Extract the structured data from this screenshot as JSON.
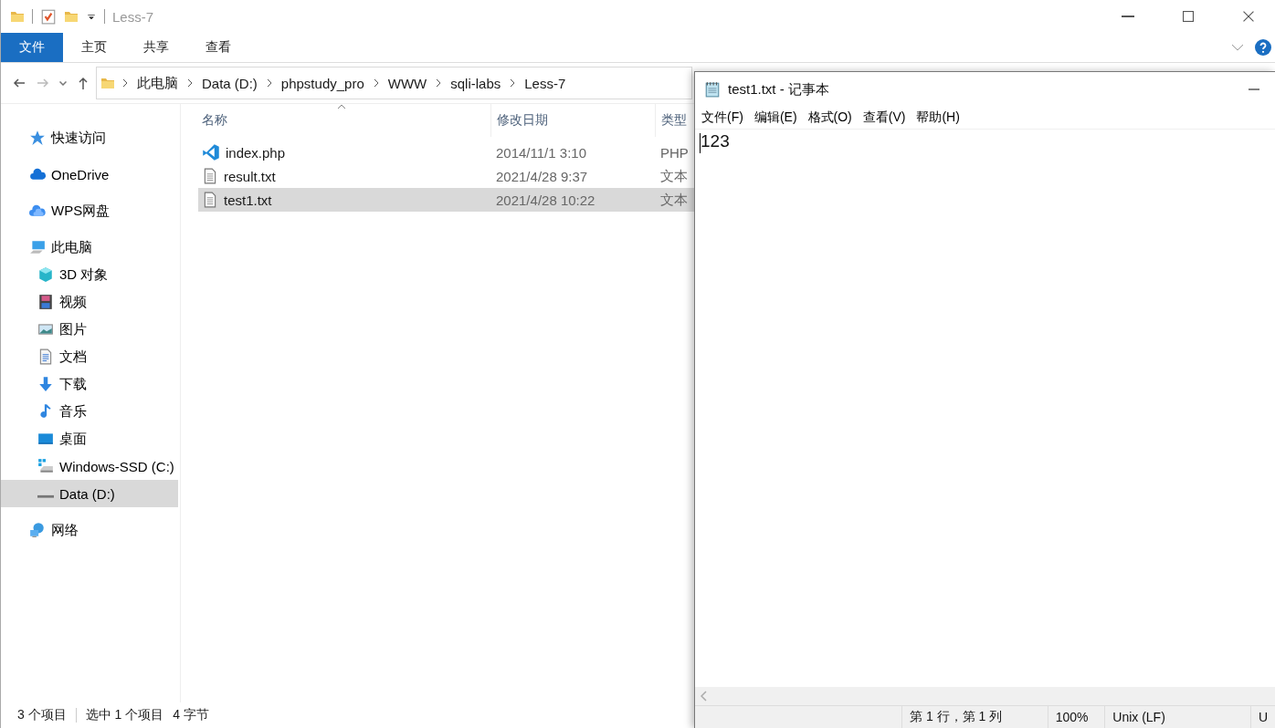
{
  "explorer": {
    "title": "Less-7",
    "ribbon_tabs": [
      {
        "label": "文件",
        "selected": true
      },
      {
        "label": "主页",
        "selected": false
      },
      {
        "label": "共享",
        "selected": false
      },
      {
        "label": "查看",
        "selected": false
      }
    ],
    "breadcrumb": [
      "此电脑",
      "Data (D:)",
      "phpstudy_pro",
      "WWW",
      "sqli-labs",
      "Less-7"
    ],
    "sidebar": {
      "items": [
        {
          "label": "快速访问",
          "selected": false
        },
        {
          "label": "OneDrive",
          "selected": false
        },
        {
          "label": "WPS网盘",
          "selected": false
        },
        {
          "label": "此电脑",
          "selected": false,
          "children": [
            {
              "label": "3D 对象",
              "selected": false
            },
            {
              "label": "视频",
              "selected": false
            },
            {
              "label": "图片",
              "selected": false
            },
            {
              "label": "文档",
              "selected": false
            },
            {
              "label": "下载",
              "selected": false
            },
            {
              "label": "音乐",
              "selected": false
            },
            {
              "label": "桌面",
              "selected": false
            },
            {
              "label": "Windows-SSD (C:)",
              "selected": false
            },
            {
              "label": "Data (D:)",
              "selected": true
            }
          ]
        },
        {
          "label": "网络",
          "selected": false
        }
      ]
    },
    "file_list": {
      "columns": [
        "名称",
        "修改日期",
        "类型"
      ],
      "rows": [
        {
          "name": "index.php",
          "modified": "2014/11/1 3:10",
          "type": "PHP",
          "kind": "code",
          "selected": false
        },
        {
          "name": "result.txt",
          "modified": "2021/4/28 9:37",
          "type": "文本",
          "kind": "text",
          "selected": false
        },
        {
          "name": "test1.txt",
          "modified": "2021/4/28 10:22",
          "type": "文本",
          "kind": "text",
          "selected": true
        }
      ]
    },
    "status_bar": [
      "3 个项目",
      "选中 1 个项目",
      "4 字节"
    ]
  },
  "notepad": {
    "title": "test1.txt - 记事本",
    "menu": [
      "文件(F)",
      "编辑(E)",
      "格式(O)",
      "查看(V)",
      "帮助(H)"
    ],
    "content": "123",
    "status_bar": [
      "第 1 行，第 1 列",
      "100%",
      "Unix (LF)",
      "U"
    ]
  }
}
